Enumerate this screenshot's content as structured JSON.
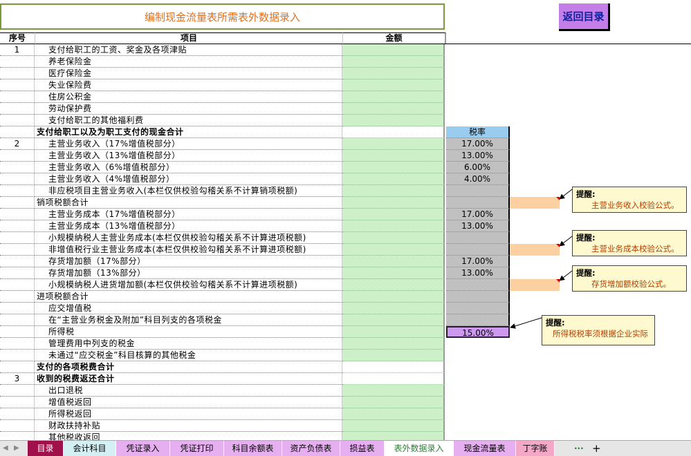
{
  "header": {
    "title": "编制现金流量表所需表外数据录入",
    "back_button": "返回目录"
  },
  "columns": {
    "seq": "序号",
    "item": "项目",
    "amount": "金额",
    "rate": "税率"
  },
  "rows": [
    {
      "seq": "1",
      "label": "支付给职工的工资、奖金及各项津贴"
    },
    {
      "seq": "",
      "label": "养老保险金"
    },
    {
      "seq": "",
      "label": "医疗保险金"
    },
    {
      "seq": "",
      "label": "失业保险费"
    },
    {
      "seq": "",
      "label": "住房公积金"
    },
    {
      "seq": "",
      "label": "劳动保护费"
    },
    {
      "seq": "",
      "label": "支付给职工的其他福利费"
    },
    {
      "seq": "",
      "label": "支付给职工以及为职工支付的现金合计",
      "bold": true,
      "rate": "税率"
    },
    {
      "seq": "2",
      "label": "主营业务收入（17%增值税部分）",
      "rate": "17.00%"
    },
    {
      "seq": "",
      "label": "主营业务收入（13%增值税部分）",
      "rate": "13.00%"
    },
    {
      "seq": "",
      "label": "主营业务收入（6%增值税部分）",
      "rate": "6.00%"
    },
    {
      "seq": "",
      "label": "主营业务收入（4%增值税部分）",
      "rate": "4.00%"
    },
    {
      "seq": "",
      "label": "非应税项目主营业务收入(本栏仅供校验勾稽关系不计算销项税额)",
      "rate": ""
    },
    {
      "seq": "",
      "label": "销项税额合计",
      "rate": ""
    },
    {
      "seq": "",
      "label": "主营业务成本（17%增值税部分）",
      "rate": "17.00%"
    },
    {
      "seq": "",
      "label": "主营业务成本（13%增值税部分）",
      "rate": "13.00%"
    },
    {
      "seq": "",
      "label": "小规模纳税人主营业务成本(本栏仅供校验勾稽关系不计算进项税额)",
      "rate": ""
    },
    {
      "seq": "",
      "label": "非增值税行业主营业务成本(本栏仅供校验勾稽关系不计算进项税额)",
      "rate": ""
    },
    {
      "seq": "",
      "label": "存货增加额（17%部分）",
      "rate": "17.00%"
    },
    {
      "seq": "",
      "label": "存货增加额（13%部分）",
      "rate": "13.00%"
    },
    {
      "seq": "",
      "label": "小规模纳税人进货增加额(本栏仅供校验勾稽关系不计算进项税额)",
      "rate": ""
    },
    {
      "seq": "",
      "label": "进项税额合计",
      "rate": ""
    },
    {
      "seq": "",
      "label": "应交增值税",
      "rate": ""
    },
    {
      "seq": "",
      "label": "在“主营业务税金及附加”科目列支的各项税金",
      "rate": ""
    },
    {
      "seq": "",
      "label": "所得税",
      "rate": "15.00%"
    },
    {
      "seq": "",
      "label": "管理费用中列支的税金"
    },
    {
      "seq": "",
      "label": "未通过“应交税金”科目核算的其他税金"
    },
    {
      "seq": "",
      "label": "支付的各项税费合计",
      "bold": true
    },
    {
      "seq": "3",
      "label": "收到的税费返还合计",
      "bold": true
    },
    {
      "seq": "",
      "label": "出口退税"
    },
    {
      "seq": "",
      "label": "增值税返回"
    },
    {
      "seq": "",
      "label": "所得税返回"
    },
    {
      "seq": "",
      "label": "财政扶持补贴"
    },
    {
      "seq": "",
      "label": "其他税收返回"
    }
  ],
  "notes": [
    {
      "title": "提醒:",
      "body": "主营业务收入校验公式。"
    },
    {
      "title": "提醒:",
      "body": "主营业务成本校验公式。"
    },
    {
      "title": "提醒:",
      "body": "存货增加额校验公式。"
    },
    {
      "title": "提醒:",
      "body": "所得税税率须根据企业实际"
    }
  ],
  "tabs": [
    {
      "label": "目录",
      "color": "#a0104a",
      "text_color": "#ffffff"
    },
    {
      "label": "会计科目",
      "color": "#d4f0f4",
      "text_color": "#000000"
    },
    {
      "label": "凭证录入",
      "color": "#e6b0f0",
      "text_color": "#000000"
    },
    {
      "label": "凭证打印",
      "color": "#e6b0f0",
      "text_color": "#000000"
    },
    {
      "label": "科目余额表",
      "color": "#e6b0f0",
      "text_color": "#000000"
    },
    {
      "label": "资产负债表",
      "color": "#e6b0f0",
      "text_color": "#000000"
    },
    {
      "label": "损益表",
      "color": "#e6b0f0",
      "text_color": "#000000"
    },
    {
      "label": "表外数据录入",
      "color": "#ffffff",
      "text_color": "#2e7d32"
    },
    {
      "label": "现金流量表",
      "color": "#e6b0f0",
      "text_color": "#000000"
    },
    {
      "label": "丁字账",
      "color": "#f4a8c8",
      "text_color": "#000000"
    }
  ],
  "tab_more": "···",
  "tab_add": "+"
}
